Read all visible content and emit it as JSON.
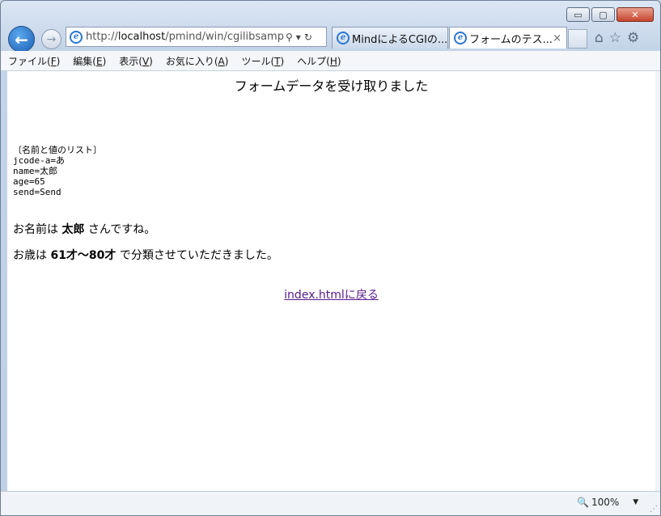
{
  "toolbar": {
    "address": {
      "prefix": "http://",
      "host": "localhost",
      "path": "/pmind/win/cgilibsample/t"
    },
    "tabs": [
      {
        "label": "MindによるCGIの..."
      },
      {
        "label": "フォームのテス...",
        "close": "×"
      }
    ],
    "icons": [
      "back-arrow-icon",
      "forward-arrow-icon",
      "ie-logo-icon",
      "search-icon",
      "dropdown-icon",
      "refresh-icon",
      "home-icon",
      "favorites-star-icon",
      "gear-icon",
      "close-icon",
      "zoom-icon"
    ]
  },
  "window_controls": {
    "minimize": "▭",
    "maximize": "▢",
    "close": "✕"
  },
  "menu": [
    {
      "label": "ファイル(",
      "key": "F",
      "end": ")"
    },
    {
      "label": "編集(",
      "key": "E",
      "end": ")"
    },
    {
      "label": "表示(",
      "key": "V",
      "end": ")"
    },
    {
      "label": "お気に入り(",
      "key": "A",
      "end": ")"
    },
    {
      "label": "ツール(",
      "key": "T",
      "end": ")"
    },
    {
      "label": "ヘルプ(",
      "key": "H",
      "end": ")"
    }
  ],
  "page": {
    "heading": "フォームデータを受け取りました",
    "list": [
      "〔名前と値のリスト〕",
      "jcode-a=あ",
      "name=太郎",
      "age=65",
      "send=Send"
    ],
    "name_sentence": {
      "before": "お名前は ",
      "value": "太郎",
      "after": " さんですね。"
    },
    "age_sentence": {
      "before": "お歳は ",
      "value": "61才〜80才",
      "after": " で分類させていただきました。"
    },
    "back_link": "index.htmlに戻る"
  },
  "status": {
    "zoom": "100%"
  }
}
